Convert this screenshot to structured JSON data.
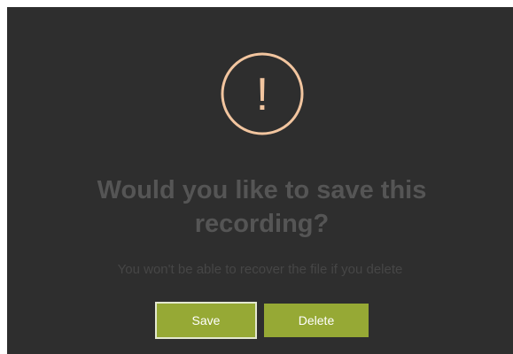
{
  "dialog": {
    "icon": "exclamation-circle-icon",
    "icon_glyph": "!",
    "icon_color": "#f2c59f",
    "background": "#2e2e2e",
    "title": "Would you like to save this recording?",
    "subtitle": "You won't be able to recover the file if you delete",
    "buttons": {
      "save_label": "Save",
      "delete_label": "Delete",
      "accent": "#96a935",
      "focused": "save"
    }
  }
}
